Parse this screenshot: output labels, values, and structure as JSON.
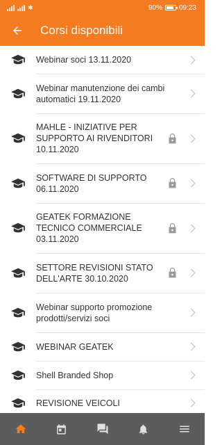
{
  "status_bar": {
    "battery": "90%",
    "time": "09:23"
  },
  "header": {
    "title": "Corsi disponibili"
  },
  "courses": [
    {
      "title": "Webinar soci 13.11.2020",
      "locked": false
    },
    {
      "title": "Webinar manutenzione dei cambi automatici 19.11.2020",
      "locked": false
    },
    {
      "title": "MAHLE - INIZIATIVE PER SUPPORTO AI RIVENDITORI 10.11.2020",
      "locked": true
    },
    {
      "title": "SOFTWARE DI SUPPORTO 06.11.2020",
      "locked": true
    },
    {
      "title": "GEATEK FORMAZIONE TECNICO COMMERCIALE 03.11.2020",
      "locked": true
    },
    {
      "title": "SETTORE REVISIONI STATO DELL'ARTE 30.10.2020",
      "locked": true
    },
    {
      "title": "Webinar supporto promozione prodotti/servizi soci",
      "locked": false
    },
    {
      "title": "WEBINAR GEATEK",
      "locked": false
    },
    {
      "title": "Shell Branded Shop",
      "locked": false
    },
    {
      "title": "REVISIONE VEICOLI",
      "locked": false
    }
  ],
  "bottom_nav": [
    {
      "icon": "home-icon",
      "active": true
    },
    {
      "icon": "calendar-icon",
      "active": false
    },
    {
      "icon": "chat-icon",
      "active": false
    },
    {
      "icon": "bell-icon",
      "active": false
    },
    {
      "icon": "menu-icon",
      "active": false
    }
  ],
  "colors": {
    "accent": "#f47b20",
    "nav_bg": "#5c5c5c",
    "nav_icon": "#e0e0e0"
  }
}
